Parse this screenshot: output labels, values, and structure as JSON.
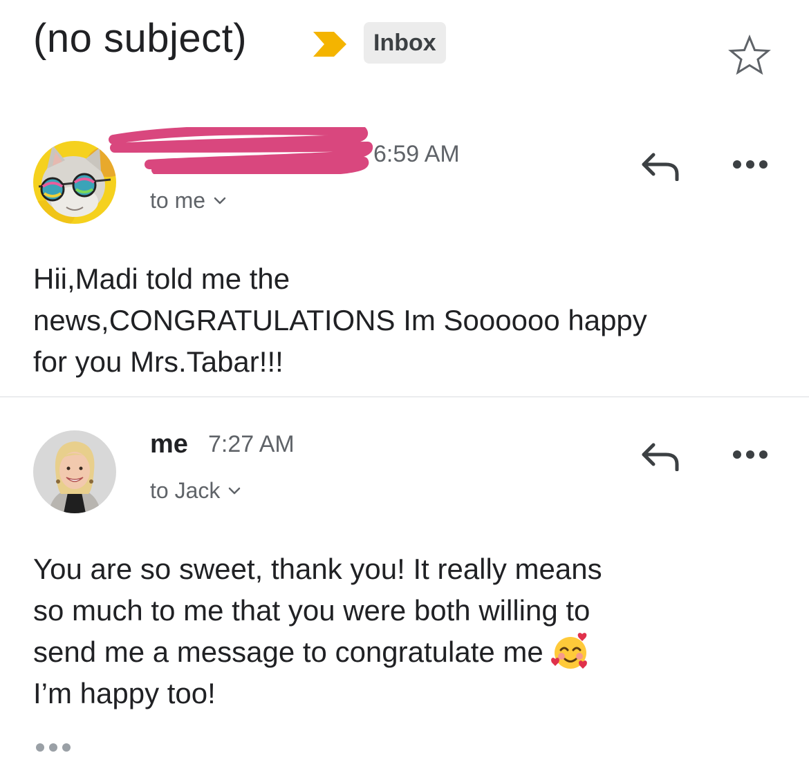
{
  "thread": {
    "subject": "(no subject)",
    "label": "Inbox",
    "colors": {
      "importance": "#F4B400",
      "redaction": "#D9477E",
      "muted": "#5f6368"
    }
  },
  "messages": [
    {
      "time": "6:59 AM",
      "recipient": "to me",
      "body_lines": [
        "Hii,Madi told me the",
        "news,CONGRATULATIONS Im Soooooo happy",
        "for you Mrs.Tabar!!!"
      ],
      "avatar_icon": "cat-with-sunglasses-avatar"
    },
    {
      "sender": "me",
      "time": "7:27 AM",
      "recipient": "to Jack",
      "body_lines": [
        "You are so sweet, thank you! It really means",
        "so much to me that you were both willing to",
        "send me a message to congratulate me",
        "I’m happy too!"
      ],
      "avatar_icon": "smiling-woman-avatar",
      "emoji": "smiling-face-with-hearts"
    }
  ]
}
